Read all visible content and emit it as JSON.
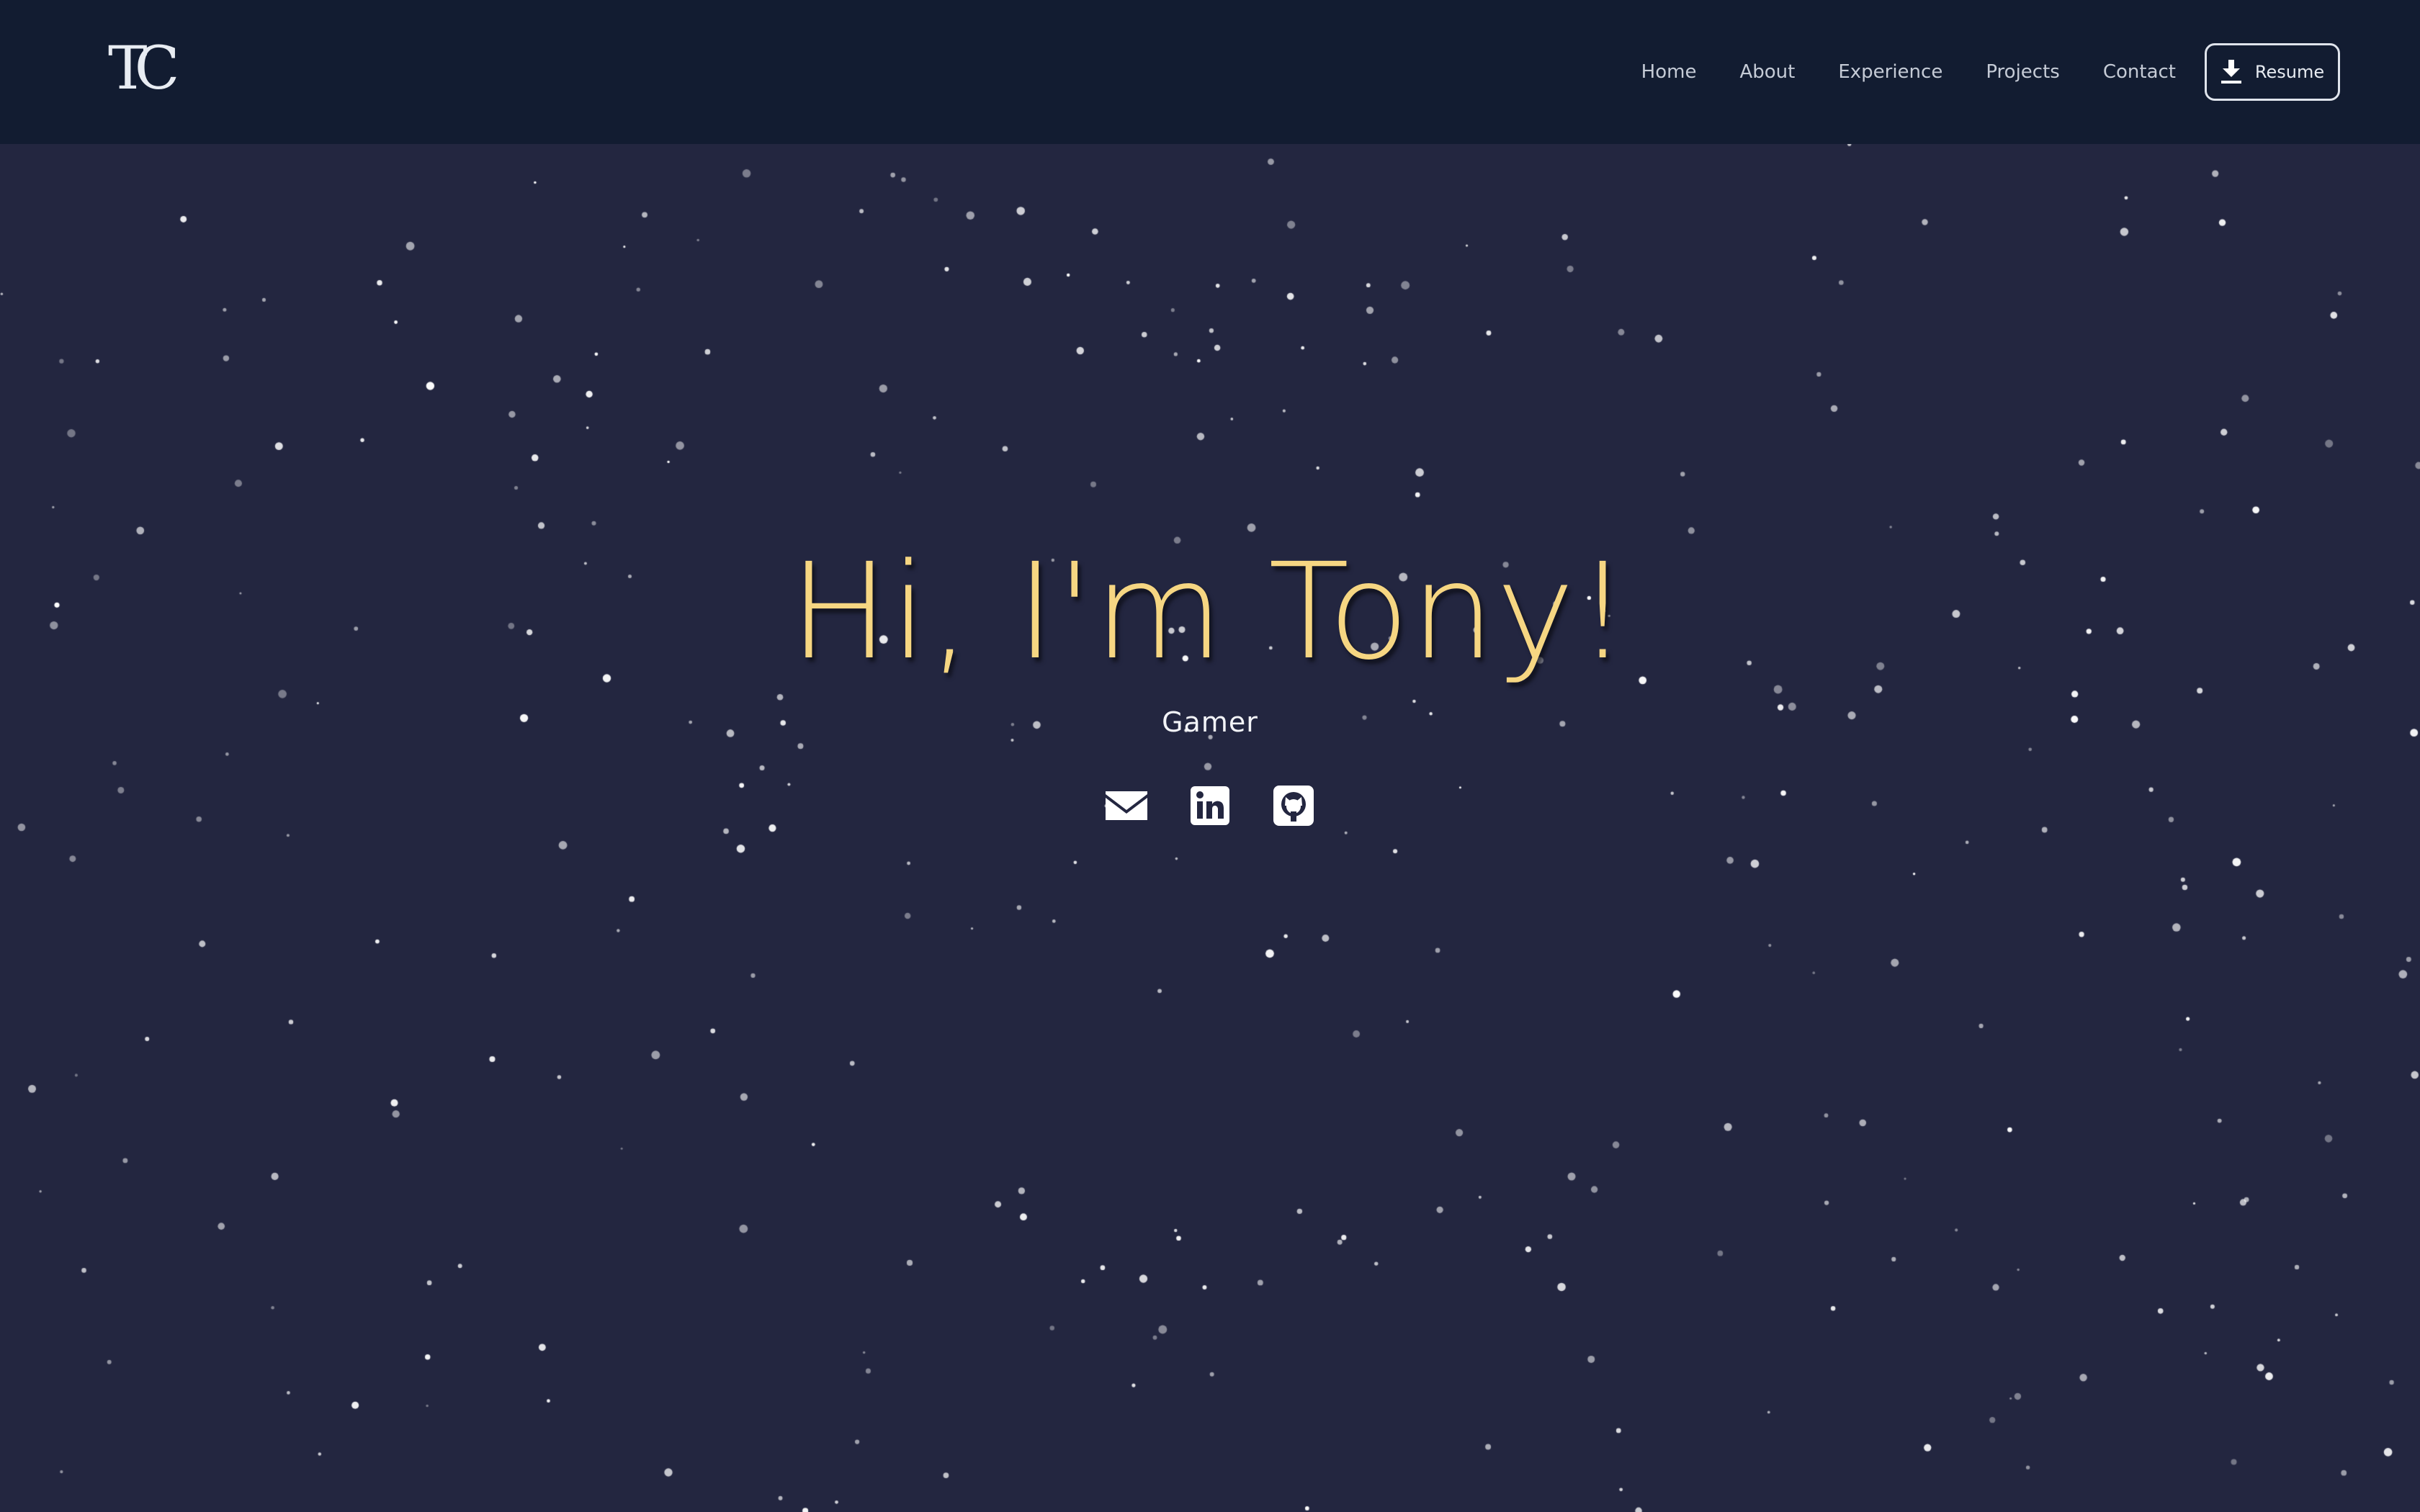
{
  "navbar": {
    "logo_text": "TC",
    "links": [
      "Home",
      "About",
      "Experience",
      "Projects",
      "Contact"
    ],
    "resume_label": "Resume"
  },
  "hero": {
    "title": "Hi, I'm Tony!",
    "subtitle": "Gamer"
  },
  "social_icons": [
    "email-icon",
    "linkedin-icon",
    "github-icon"
  ],
  "colors": {
    "background": "#232640",
    "navbar": "#121c31",
    "accent": "#f6d682",
    "text": "#e8ecf2"
  }
}
